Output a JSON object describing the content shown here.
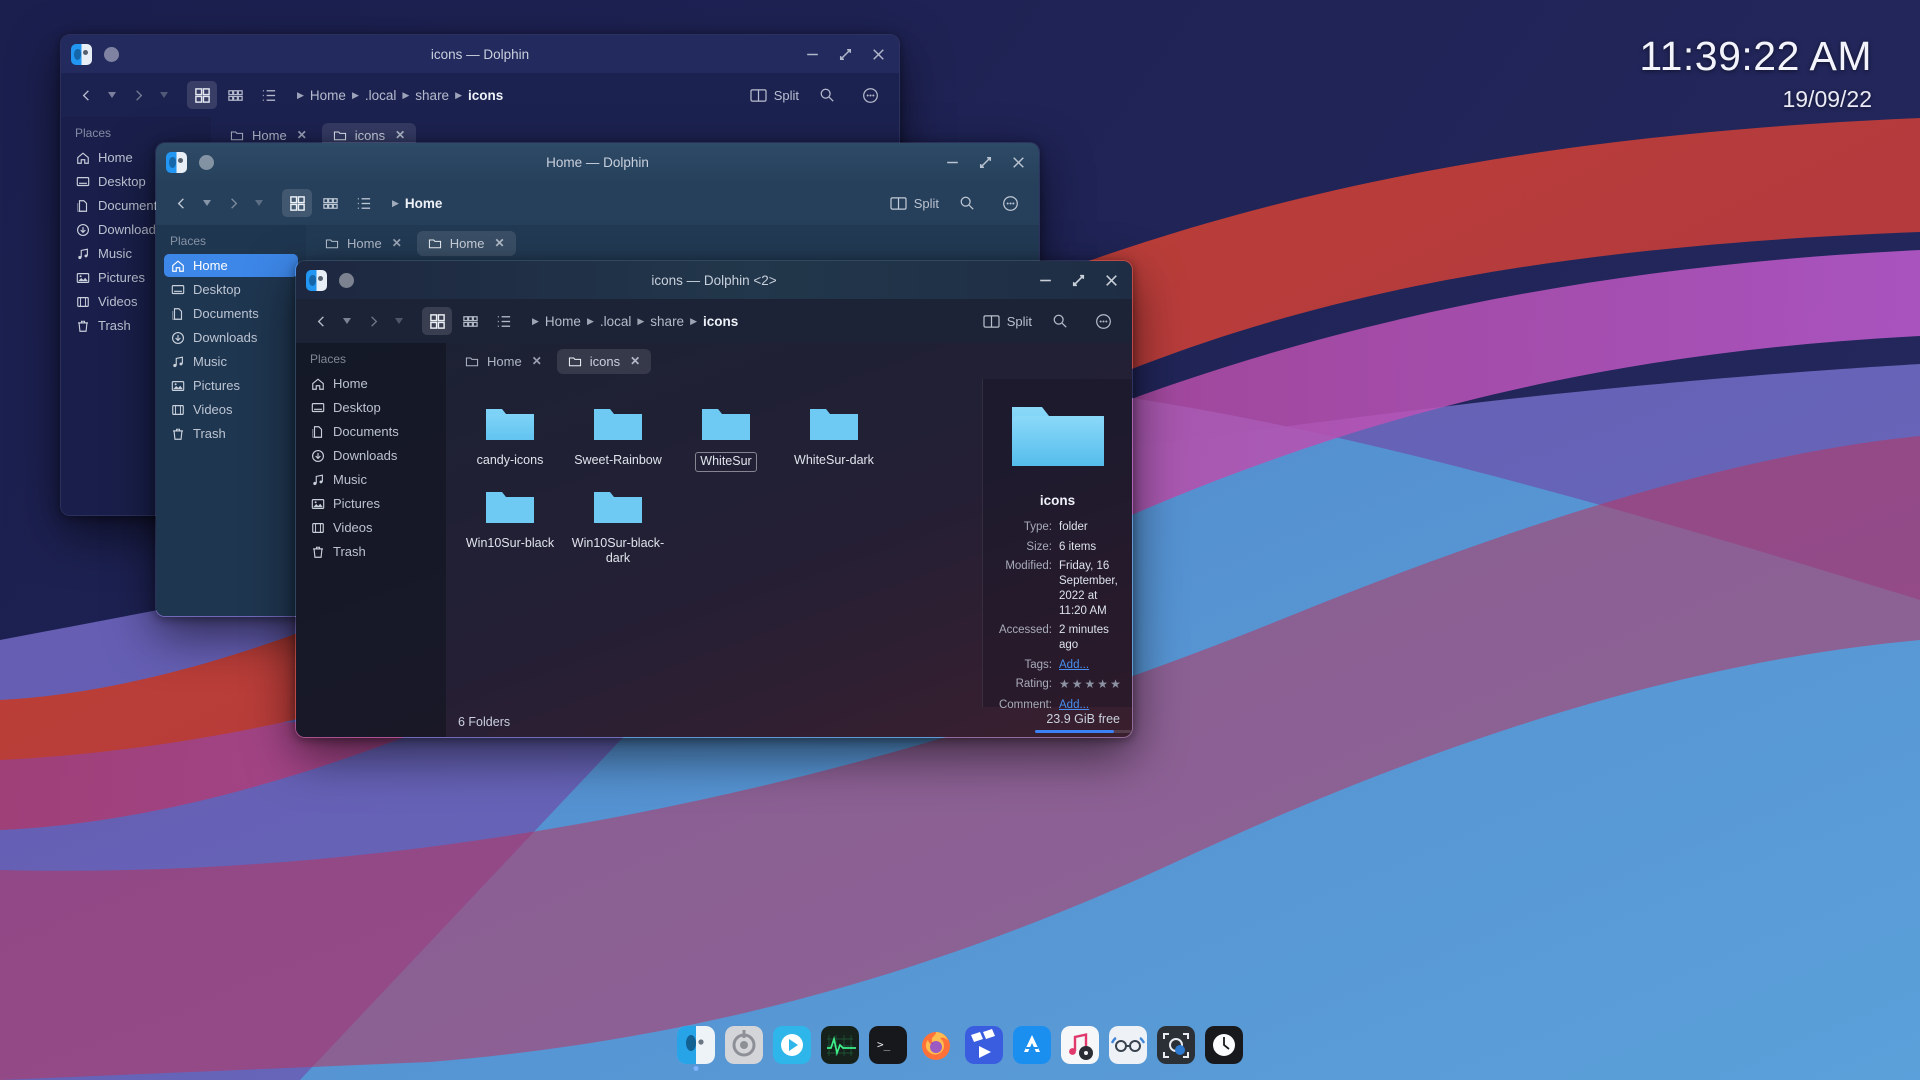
{
  "desktop": {
    "clock": {
      "time": "11:39:22 AM",
      "date": "19/09/22"
    },
    "wallpaper_colors": {
      "navy": "#1d2150",
      "slate_blue": "#5560a0",
      "red": "#c0412f",
      "magenta": "#b8358a",
      "purple": "#7b4fd0",
      "cyan": "#4a9ad4"
    }
  },
  "accent": "#3d87e8",
  "places": {
    "header": "Places",
    "items": [
      {
        "label": "Home",
        "icon": "home-icon"
      },
      {
        "label": "Desktop",
        "icon": "desktop-icon"
      },
      {
        "label": "Documents",
        "icon": "documents-icon"
      },
      {
        "label": "Downloads",
        "icon": "downloads-icon"
      },
      {
        "label": "Music",
        "icon": "music-icon"
      },
      {
        "label": "Pictures",
        "icon": "pictures-icon"
      },
      {
        "label": "Videos",
        "icon": "videos-icon"
      },
      {
        "label": "Trash",
        "icon": "trash-icon"
      }
    ]
  },
  "toolbar": {
    "split_label": "Split",
    "back_icon": "chevron-left-icon",
    "forward_icon": "chevron-right-icon",
    "view_icons_label": "Icons view",
    "view_compact_label": "Compact view",
    "view_details_label": "Details view",
    "search_icon": "search-icon",
    "menu_icon": "hamburger-menu-icon"
  },
  "windows": {
    "back": {
      "title": "icons — Dolphin",
      "breadcrumb": [
        "Home",
        ".local",
        "share",
        "icons"
      ],
      "tabs": [
        {
          "label": "Home",
          "active": false
        },
        {
          "label": "icons",
          "active": true
        }
      ]
    },
    "mid": {
      "title": "Home — Dolphin",
      "breadcrumb": [
        "Home"
      ],
      "tabs": [
        {
          "label": "Home",
          "active": false
        },
        {
          "label": "Home",
          "active": true
        }
      ],
      "selected_place": "Home"
    },
    "front": {
      "title": "icons — Dolphin <2>",
      "breadcrumb": [
        "Home",
        ".local",
        "share",
        "icons"
      ],
      "tabs": [
        {
          "label": "Home",
          "active": false
        },
        {
          "label": "icons",
          "active": true
        }
      ],
      "files": [
        {
          "name": "candy-icons",
          "type": "folder",
          "focused": false
        },
        {
          "name": "Sweet-Rainbow",
          "type": "folder",
          "focused": false
        },
        {
          "name": "WhiteSur",
          "type": "folder",
          "focused": true
        },
        {
          "name": "WhiteSur-dark",
          "type": "folder",
          "focused": false
        },
        {
          "name": "Win10Sur-black",
          "type": "folder",
          "focused": false
        },
        {
          "name": "Win10Sur-black-dark",
          "type": "folder",
          "focused": false
        }
      ],
      "statusbar": {
        "count": "6 Folders",
        "free": "23.9 GiB free",
        "used_percent": 82
      },
      "info": {
        "name": "icons",
        "rows": [
          {
            "key": "Type:",
            "value": "folder",
            "link": false
          },
          {
            "key": "Size:",
            "value": "6 items",
            "link": false
          },
          {
            "key": "Modified:",
            "value": "Friday, 16 September, 2022 at 11:20 AM",
            "link": false
          },
          {
            "key": "Accessed:",
            "value": "2 minutes ago",
            "link": false
          },
          {
            "key": "Tags:",
            "value": "Add...",
            "link": true
          },
          {
            "key": "Rating:",
            "value": "",
            "link": false,
            "stars": 5
          },
          {
            "key": "Comment:",
            "value": "Add...",
            "link": true
          }
        ]
      }
    }
  },
  "dock": {
    "items": [
      {
        "name": "dolphin-file-manager",
        "running": true
      },
      {
        "name": "system-settings",
        "running": false
      },
      {
        "name": "media-player",
        "running": false
      },
      {
        "name": "system-monitor",
        "running": false
      },
      {
        "name": "terminal",
        "running": false
      },
      {
        "name": "firefox-browser",
        "running": false
      },
      {
        "name": "video-editor",
        "running": false
      },
      {
        "name": "app-store",
        "running": false
      },
      {
        "name": "music-player",
        "running": false
      },
      {
        "name": "document-viewer",
        "running": false
      },
      {
        "name": "screenshot-tool",
        "running": false
      },
      {
        "name": "clock-app",
        "running": false
      }
    ]
  }
}
